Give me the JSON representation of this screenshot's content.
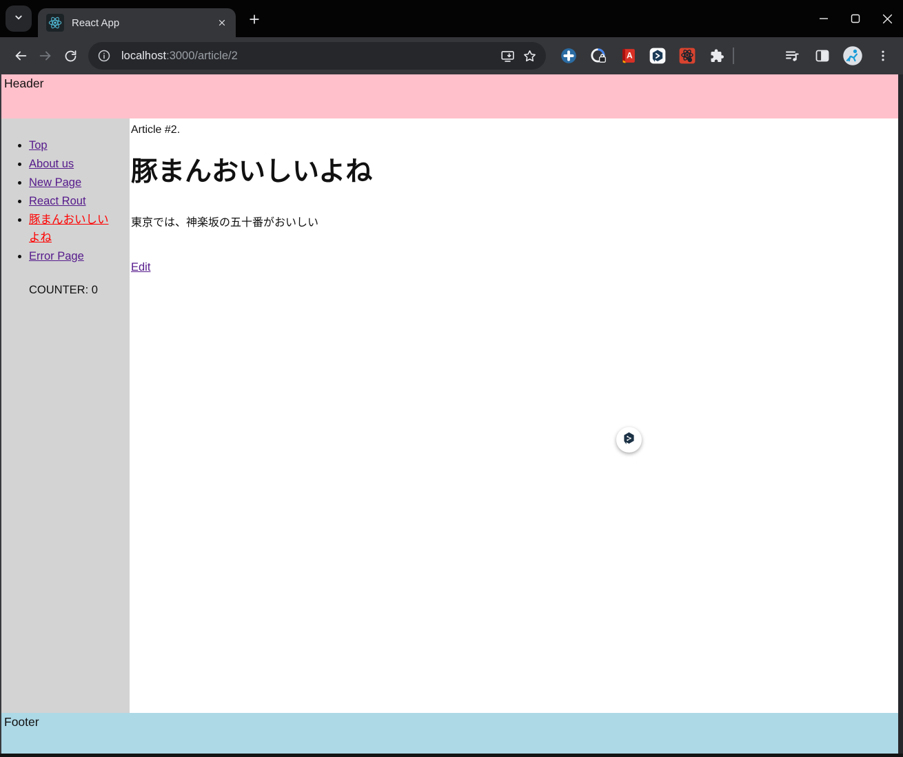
{
  "window": {
    "controls": {
      "minimize": "minimize",
      "maximize": "maximize",
      "close": "close"
    }
  },
  "browser": {
    "tab_title": "React App",
    "url_host": "localhost",
    "url_rest": ":3000/article/2"
  },
  "page": {
    "header_text": "Header",
    "sidebar": {
      "items": [
        {
          "label": "Top",
          "active": false
        },
        {
          "label": "About us",
          "active": false
        },
        {
          "label": "New Page",
          "active": false
        },
        {
          "label": "React Rout",
          "active": false
        },
        {
          "label": "豚まんおいしいよね",
          "active": true
        },
        {
          "label": "Error Page",
          "active": false
        }
      ],
      "counter_label": "COUNTER: 0"
    },
    "main": {
      "article_number": "Article #2.",
      "heading": "豚まんおいしいよね",
      "body_text": "東京では、神楽坂の五十番がおいしい",
      "edit_label": "Edit"
    },
    "footer_text": "Footer"
  },
  "colors": {
    "header_bg": "#FFC0CB",
    "sidebar_bg": "#D3D3D3",
    "footer_bg": "#ADD8E6",
    "main_bg": "#FFFFFF",
    "visited_link": "#551A8B",
    "active_link": "#FF0000",
    "titlebar_bg": "#040404",
    "toolbar_bg": "#35363A",
    "react_accent": "#53C1DE"
  },
  "icons": {
    "tab_search": "chevron-down",
    "favicon": "react-atom",
    "tab_close": "x-cross",
    "new_tab": "plus",
    "back": "arrow-left",
    "forward": "arrow-right",
    "reload": "circular-arrow",
    "site_info": "info-circle",
    "install_app": "monitor-down-arrow",
    "bookmark": "star-outline",
    "ext_1": "blue-circle-plus",
    "ext_2": "focus-timer-lock",
    "ext_3": "red-dictionary-book",
    "ext_4": "hexagon-chat-bubble",
    "ext_5": "react-devtools-atom",
    "extensions_menu": "puzzle-piece",
    "media_controls": "playlist-music-note",
    "side_panel": "panel-right-filled",
    "profile": "avatar-runner",
    "browser_menu": "three-dots-vertical",
    "floating_overlay": "hexagon-chat-bubble"
  }
}
